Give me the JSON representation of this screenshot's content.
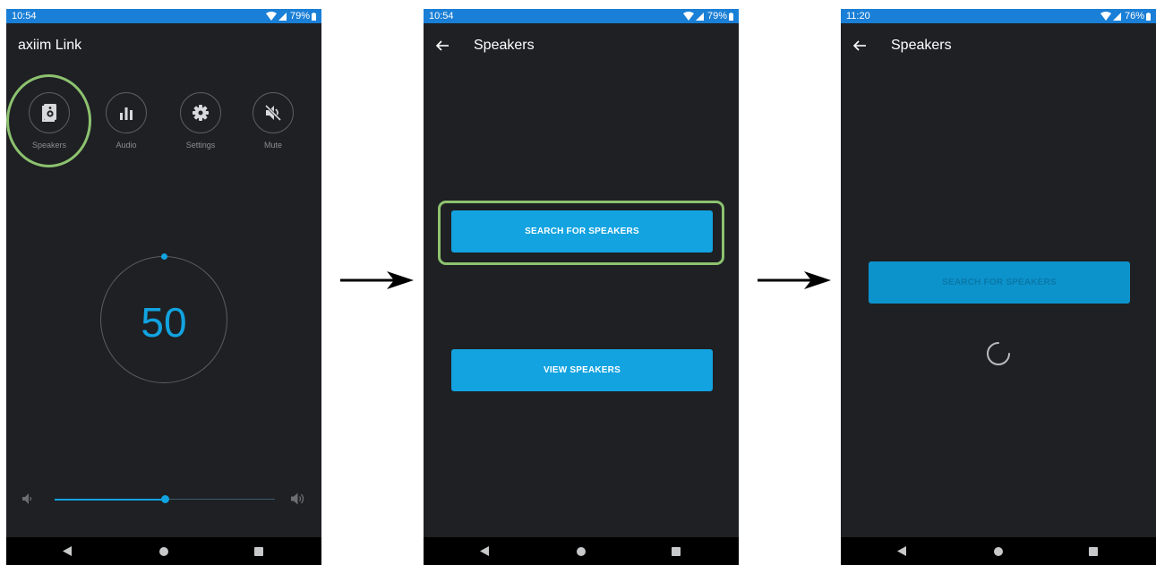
{
  "colors": {
    "accent": "#12a3e0",
    "status_bar": "#1a7fd6",
    "screen_bg": "#1e2023",
    "highlight": "#8dc26f",
    "nav_bar": "#000000"
  },
  "screen1": {
    "status": {
      "time": "10:54",
      "battery": "79%"
    },
    "title": "axiim Link",
    "menu": [
      {
        "label": "Speakers",
        "icon": "speaker-icon"
      },
      {
        "label": "Audio",
        "icon": "equalizer-icon"
      },
      {
        "label": "Settings",
        "icon": "gear-icon"
      },
      {
        "label": "Mute",
        "icon": "mute-icon"
      }
    ],
    "volume": {
      "value": "50",
      "slider_fraction": 0.5
    }
  },
  "screen2": {
    "status": {
      "time": "10:54",
      "battery": "79%"
    },
    "title": "Speakers",
    "search_label": "SEARCH FOR SPEAKERS",
    "view_label": "VIEW SPEAKERS"
  },
  "screen3": {
    "status": {
      "time": "11:20",
      "battery": "76%"
    },
    "title": "Speakers",
    "search_label": "SEARCH FOR SPEAKERS"
  }
}
